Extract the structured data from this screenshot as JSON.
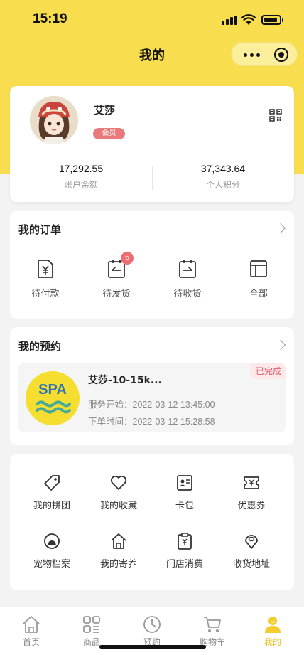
{
  "status_bar": {
    "time": "15:19"
  },
  "nav": {
    "title": "我的"
  },
  "profile": {
    "name": "艾莎",
    "badge": "会员",
    "balance_value": "17,292.55",
    "balance_label": "账户余额",
    "points_value": "37,343.64",
    "points_label": "个人积分"
  },
  "orders": {
    "title": "我的订单",
    "items": [
      {
        "label": "待付款",
        "icon": "payment-icon"
      },
      {
        "label": "待发货",
        "icon": "shipping-icon",
        "badge": "6"
      },
      {
        "label": "待收货",
        "icon": "receive-icon"
      },
      {
        "label": "全部",
        "icon": "all-orders-icon"
      }
    ]
  },
  "booking": {
    "title": "我的预约",
    "logo_text": "SPA",
    "name": "艾莎-10-15k...",
    "status": "已完成",
    "service_start": "服务开始：2022-03-12 13:45:00",
    "order_time": "下单时间：2022-03-12 15:28:58"
  },
  "menu": {
    "items": [
      {
        "label": "我的拼团",
        "icon": "tag-icon"
      },
      {
        "label": "我的收藏",
        "icon": "heart-icon"
      },
      {
        "label": "卡包",
        "icon": "card-icon"
      },
      {
        "label": "优惠券",
        "icon": "coupon-icon"
      },
      {
        "label": "宠物档案",
        "icon": "pet-icon"
      },
      {
        "label": "我的寄养",
        "icon": "house-icon"
      },
      {
        "label": "门店消费",
        "icon": "store-receipt-icon"
      },
      {
        "label": "收货地址",
        "icon": "location-icon"
      }
    ]
  },
  "tabbar": {
    "items": [
      {
        "label": "首页",
        "icon": "home-icon"
      },
      {
        "label": "商品",
        "icon": "grid-icon"
      },
      {
        "label": "预约",
        "icon": "clock-icon"
      },
      {
        "label": "购物车",
        "icon": "cart-icon"
      },
      {
        "label": "我的",
        "icon": "user-icon",
        "active": true
      }
    ]
  },
  "colors": {
    "brand_yellow": "#f8de4f",
    "badge_red": "#e97a7b",
    "active_tab": "#e8c12a"
  }
}
